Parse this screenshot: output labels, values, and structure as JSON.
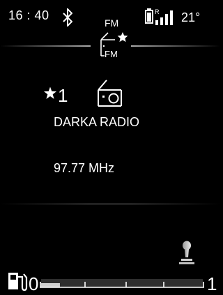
{
  "status_bar": {
    "time": "16 : 40",
    "source_mode": "FM",
    "temperature": "21°",
    "icons": [
      "bluetooth-icon",
      "battery-icon",
      "signal-strength-icon"
    ]
  },
  "header": {
    "source_icon": "radio-fm-favorite-icon",
    "source_icon_text": "FM"
  },
  "station": {
    "preset_icon": "star-icon",
    "preset_number": "1",
    "type_icon": "radio-icon",
    "name": "DARKA RADIO",
    "frequency": "97.77 MHz"
  },
  "bottom": {
    "gear_icon": "gear-shift-icon",
    "fuel_icon": "fuel-pump-icon",
    "fuel_gauge": {
      "min_label": "0",
      "max_label": "1",
      "level": 0.03
    }
  },
  "colors": {
    "background": "#000000",
    "text": "#ffffff",
    "gauge_bar": "#3a3a3a"
  }
}
